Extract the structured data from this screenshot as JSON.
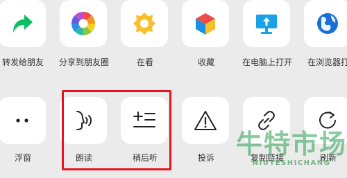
{
  "share_panel": {
    "row1": [
      {
        "label": "转发给朋友",
        "icon": "forward-arrow-icon"
      },
      {
        "label": "分享到朋友圈",
        "icon": "moments-aperture-icon"
      },
      {
        "label": "在看",
        "icon": "wow-star-icon"
      },
      {
        "label": "收藏",
        "icon": "favorites-cube-icon"
      },
      {
        "label": "在电脑上打开",
        "icon": "computer-open-icon"
      },
      {
        "label": "在浏览器打",
        "icon": "browser-globe-icon"
      }
    ],
    "row2": [
      {
        "label": "浮窗",
        "icon": "floating-window-icon"
      },
      {
        "label": "朗读",
        "icon": "read-aloud-icon"
      },
      {
        "label": "稍后听",
        "icon": "listen-later-icon"
      },
      {
        "label": "投诉",
        "icon": "warning-triangle-icon"
      },
      {
        "label": "复制链接",
        "icon": "link-icon"
      },
      {
        "label": "刷新",
        "icon": "refresh-icon"
      }
    ]
  },
  "watermark": {
    "title": "牛特市场",
    "subtitle": "NIUTESHICHANG"
  },
  "colors": {
    "forward_green": "#07c160",
    "highlight_red": "#e8141b",
    "monitor_blue": "#1aa1e6",
    "globe_blue": "#1a6fd6",
    "star_yellow": "#f7c02a",
    "icon_dark": "#222222"
  }
}
